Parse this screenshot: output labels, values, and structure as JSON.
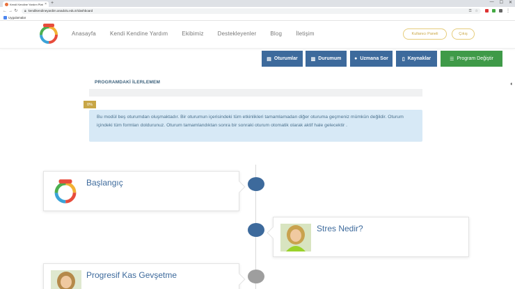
{
  "browser": {
    "tab_title": "Kendi Kendine Yardım Platfor",
    "tab_close": "×",
    "new_tab": "+",
    "window_controls": [
      "—",
      "☐",
      "✕"
    ],
    "url": "kendikendineyardim.anadolu.edu.tr/dashboard",
    "bookmark": "Uygulamalar"
  },
  "header": {
    "nav": [
      "Anasayfa",
      "Kendi Kendine Yardım",
      "Ekibimiz",
      "Destekleyenler",
      "Blog",
      "İletişim"
    ],
    "panel_button": "Kullanıcı Paneli",
    "exit_button": "Çıkış"
  },
  "actions": {
    "sessions": "Oturumlar",
    "status": "Durumum",
    "ask_expert": "Uzmana Sor",
    "resources": "Kaynaklar",
    "change_program": "Program Değiştir"
  },
  "progress": {
    "title": "PROGRAMDAKİ İLERLEMEM",
    "percent_label": "0%",
    "percent_value": 0,
    "info": "Bu modül beş oturumdan oluşmaktadır. Bir oturumun içerisindeki tüm etkinlikleri tamamlamadan diğer oturuma geçmeniz mümkün değildir. Oturum içindeki tüm formları doldurunuz. Oturum tamamlandıktan sonra bir sonraki oturum otomatik olarak aktif hale gelecektir ."
  },
  "timeline": [
    {
      "title": "Başlangıç",
      "image": "logo-icon",
      "status": "active"
    },
    {
      "title": "Stres Nedir?",
      "image": "avatar-woman-icon",
      "status": "active"
    },
    {
      "title": "Progresif Kas Gevşetme",
      "image": "avatar-woman-icon",
      "status": "locked"
    }
  ],
  "colors": {
    "primary": "#3d6a9c",
    "success": "#3f9a48",
    "gold": "#c8a646",
    "info_bg": "#d7e9f6"
  }
}
